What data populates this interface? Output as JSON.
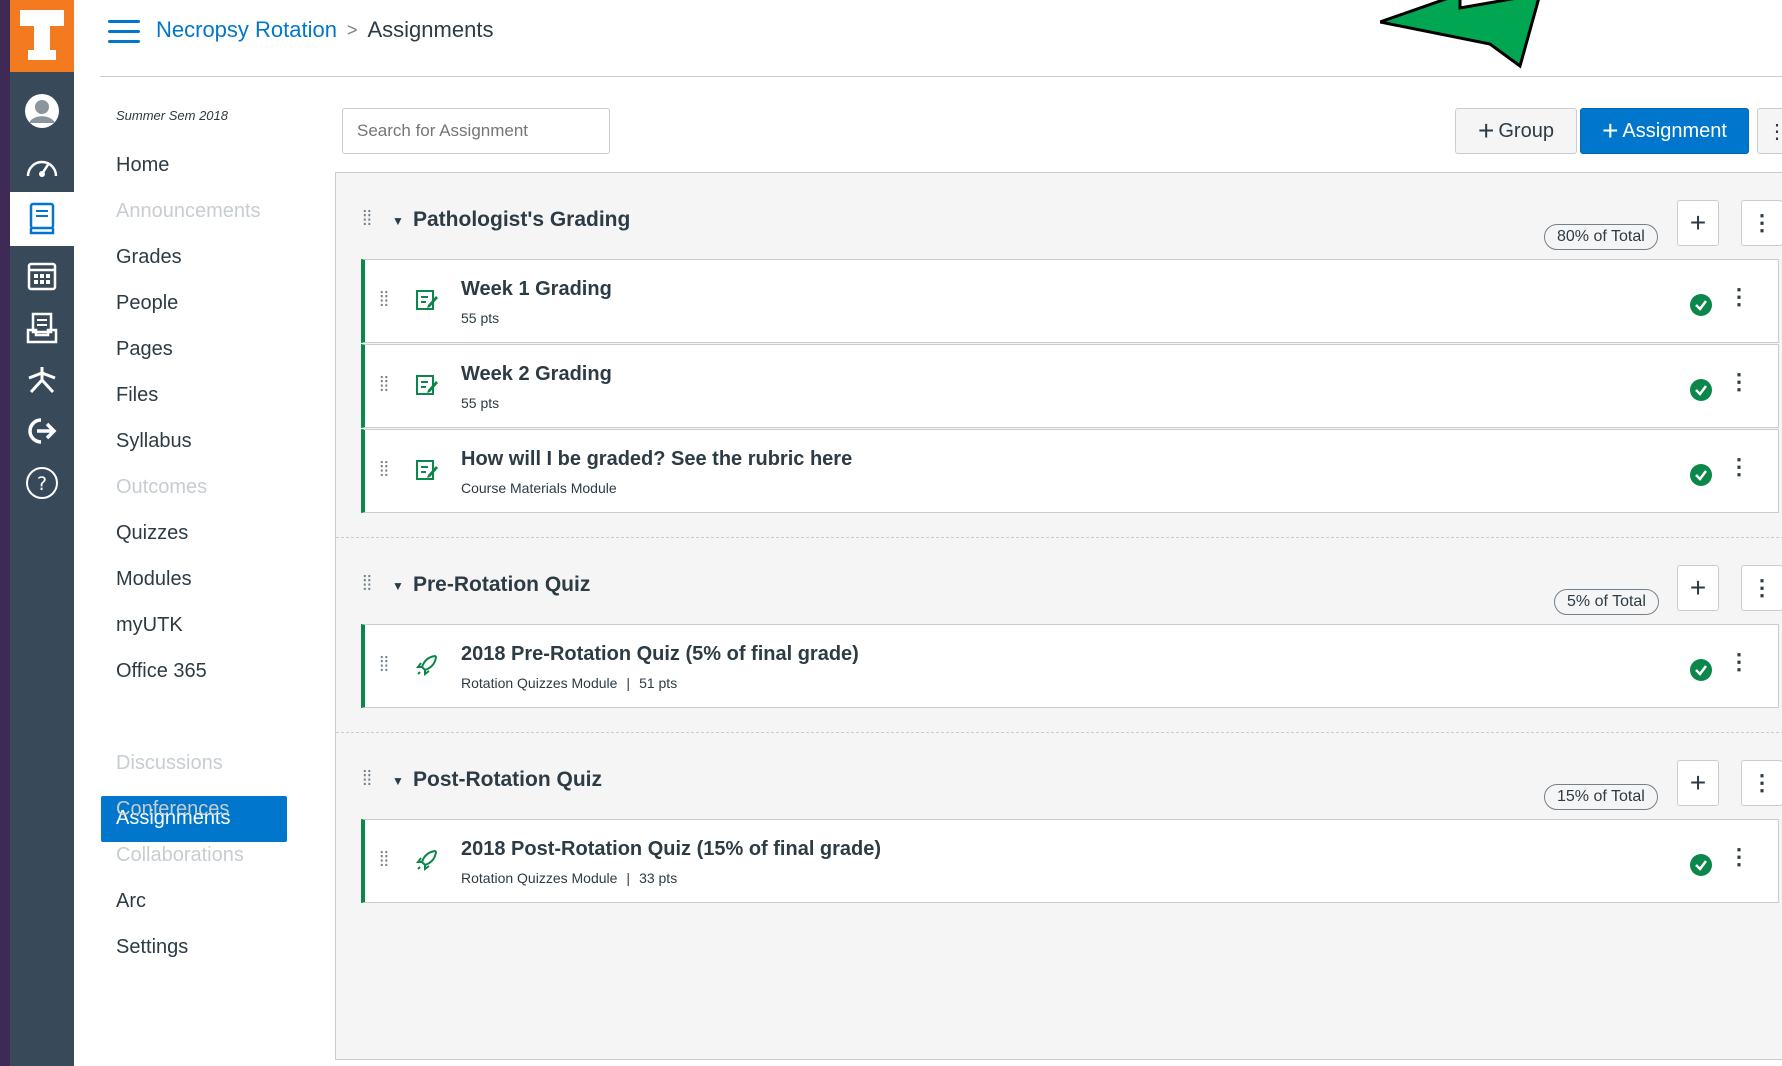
{
  "breadcrumb": {
    "course": "Necropsy Rotation",
    "separator": ">",
    "current": "Assignments"
  },
  "course_nav": {
    "term": "Summer Sem 2018",
    "items": [
      {
        "label": "Home",
        "disabled": false
      },
      {
        "label": "Announcements",
        "disabled": true
      },
      {
        "label": "Grades",
        "disabled": false
      },
      {
        "label": "People",
        "disabled": false
      },
      {
        "label": "Pages",
        "disabled": false
      },
      {
        "label": "Files",
        "disabled": false
      },
      {
        "label": "Syllabus",
        "disabled": false
      },
      {
        "label": "Outcomes",
        "disabled": true
      },
      {
        "label": "Quizzes",
        "disabled": false
      },
      {
        "label": "Modules",
        "disabled": false
      },
      {
        "label": "myUTK",
        "disabled": false
      },
      {
        "label": "Office 365",
        "disabled": false
      },
      {
        "label": "Assignments",
        "active": true
      },
      {
        "label": "Discussions",
        "disabled": true
      },
      {
        "label": "Conferences",
        "disabled": true
      },
      {
        "label": "Collaborations",
        "disabled": true
      },
      {
        "label": "Arc",
        "disabled": false
      },
      {
        "label": "Settings",
        "disabled": false
      }
    ]
  },
  "toolbar": {
    "search_placeholder": "Search for Assignment",
    "group_label": "Group",
    "assignment_label": "Assignment"
  },
  "groups": [
    {
      "title": "Pathologist's Grading",
      "weight": "80% of Total",
      "items": [
        {
          "title": "Week 1 Grading",
          "module": "",
          "points": "55 pts",
          "icon": "assignment-icon"
        },
        {
          "title": "Week 2 Grading",
          "module": "",
          "points": "55 pts",
          "icon": "assignment-icon"
        },
        {
          "title": "How will I be graded? See the rubric here",
          "module": "Course Materials Module",
          "points": "",
          "icon": "assignment-icon"
        }
      ]
    },
    {
      "title": "Pre-Rotation Quiz",
      "weight": "5% of Total",
      "items": [
        {
          "title": "2018 Pre-Rotation Quiz (5% of final grade)",
          "module": "Rotation Quizzes Module",
          "points": "51 pts",
          "icon": "quiz-rocket-icon"
        }
      ]
    },
    {
      "title": "Post-Rotation Quiz",
      "weight": "15% of Total",
      "items": [
        {
          "title": "2018 Post-Rotation Quiz (15% of final grade)",
          "module": "Rotation Quizzes Module",
          "points": "33 pts",
          "icon": "quiz-rocket-icon"
        }
      ]
    }
  ],
  "colors": {
    "brand_orange": "#f47a20",
    "nav_dark": "#384a59",
    "link_blue": "#0077cc",
    "published_green": "#0b874b",
    "arrow_green": "#00a651"
  }
}
